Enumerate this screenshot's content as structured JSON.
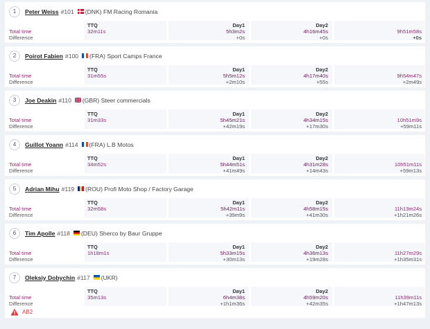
{
  "labels": {
    "total_time": "Total time",
    "difference": "Difference",
    "ttq": "TTQ",
    "day1": "Day1",
    "day2": "Day2"
  },
  "rows": [
    {
      "pos": "1",
      "name": "Peter Weiss",
      "num": "#101",
      "flag": "DNK",
      "team": "(DNK) FM Racing Romania",
      "ttq": "32m11s",
      "day1": "5h3m2s",
      "day1_diff": "+0s",
      "day2": "4h16m45s",
      "day2_diff": "+0s",
      "total": "9h51m58s",
      "total_diff": "+0s"
    },
    {
      "pos": "2",
      "name": "Poirot Fabien",
      "num": "#100",
      "flag": "FRA",
      "team": "(FRA) Sport Camps France",
      "ttq": "31m55s",
      "day1": "5h5m12s",
      "day1_diff": "+2m10s",
      "day2": "4h17m40s",
      "day2_diff": "+55s",
      "total": "9h54m47s",
      "total_diff": "+2m49s"
    },
    {
      "pos": "3",
      "name": "Joe Deakin",
      "num": "#110",
      "flag": "GBR",
      "team": "(GBR) Steer commercials",
      "ttq": "31m33s",
      "day1": "5h45m21s",
      "day1_diff": "+42m19s",
      "day2": "4h34m15s",
      "day2_diff": "+17m30s",
      "total": "10h51m9s",
      "total_diff": "+59m11s"
    },
    {
      "pos": "4",
      "name": "Guillot Yoann",
      "num": "#114",
      "flag": "FRA",
      "team": "(FRA) L.B Motos",
      "ttq": "34m52s",
      "day1": "5h44m51s",
      "day1_diff": "+41m49s",
      "day2": "4h31m28s",
      "day2_diff": "+14m43s",
      "total": "10h51m11s",
      "total_diff": "+59m13s"
    },
    {
      "pos": "5",
      "name": "Adrian Mihu",
      "num": "#119",
      "flag": "ROU",
      "team": "(ROU) Profi Moto Shop / Factory Garage",
      "ttq": "32m58s",
      "day1": "5h42m11s",
      "day1_diff": "+39m9s",
      "day2": "4h58m15s",
      "day2_diff": "+41m30s",
      "total": "11h13m24s",
      "total_diff": "+1h21m26s"
    },
    {
      "pos": "6",
      "name": "Tim Apolle",
      "num": "#118",
      "flag": "DEU",
      "team": "(DEU) Sherco by Baur Gruppe",
      "ttq": "1h18m1s",
      "day1": "5h33m15s",
      "day1_diff": "+30m13s",
      "day2": "4h36m13s",
      "day2_diff": "+19m28s",
      "total": "11h27m29s",
      "total_diff": "+1h35m31s"
    },
    {
      "pos": "7",
      "name": "Oleksiy Dobychin",
      "num": "#117",
      "flag": "UKR",
      "team": "(UKR)",
      "ttq": "35m13s",
      "day1": "6h4m38s",
      "day1_diff": "+1h1m36s",
      "day2": "4h59m20s",
      "day2_diff": "+42m35s",
      "total": "11h39m11s",
      "total_diff": "+1h47m13s"
    }
  ],
  "warning": {
    "text": "AB2",
    "icon": "warning-triangle-icon",
    "color": "#d9363e"
  },
  "colors": {
    "time": "#8b2a6e",
    "background": "#eef1f5",
    "cell": "#f5f7fb"
  }
}
